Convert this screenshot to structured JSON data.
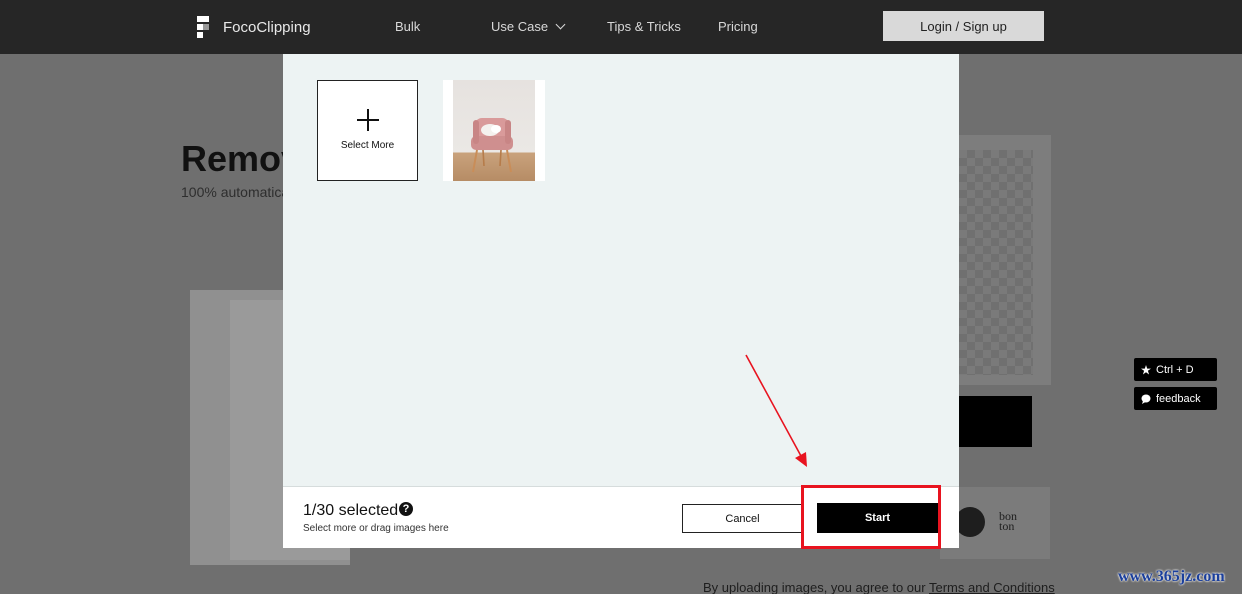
{
  "nav": {
    "logo_text": "FocoClipping",
    "links": [
      "Bulk",
      "Use Case",
      "Tips & Tricks",
      "Pricing"
    ],
    "login_label": "Login / Sign up"
  },
  "background": {
    "title": "Remov",
    "subtitle": "100% automatica",
    "terms_prefix": "By uploading images, you agree to our",
    "terms_link": "Terms and Conditions",
    "brand_text": "bon ton"
  },
  "side": {
    "bookmark_label": "Ctrl + D",
    "feedback_label": "feedback"
  },
  "modal": {
    "select_more_label": "Select More",
    "selected_count": "1/30 selected",
    "help_glyph": "?",
    "hint": "Select more or drag images here",
    "cancel_label": "Cancel",
    "start_label": "Start"
  },
  "watermark": "www.365jz.com",
  "colors": {
    "nav_bg": "#262626",
    "modal_bg": "#edf3f3",
    "primary_button": "#000000",
    "annotation": "#e8131f",
    "watermark": "#1b3f9c"
  },
  "icons": [
    "fococlipping-logo-icon",
    "chevron-down-icon",
    "plus-icon",
    "help-icon",
    "star-icon",
    "chat-bubble-icon",
    "pointer-arrow"
  ]
}
